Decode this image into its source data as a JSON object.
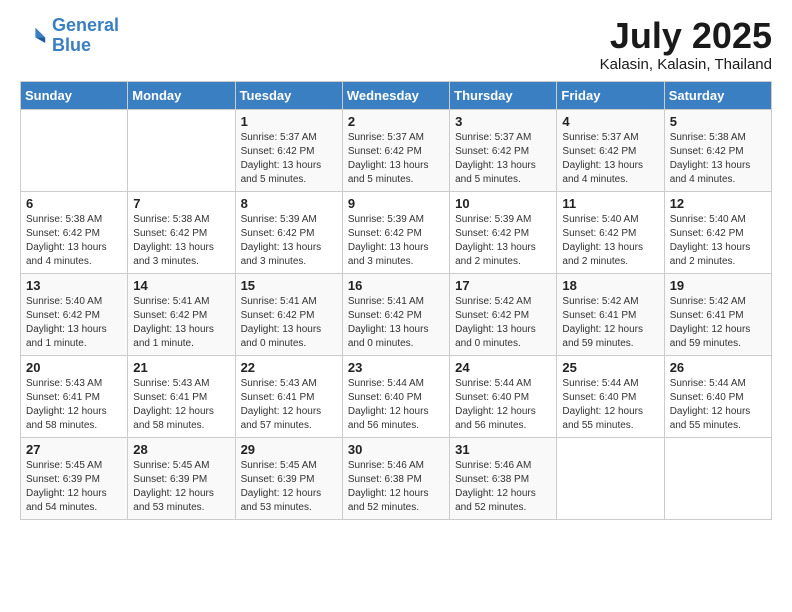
{
  "header": {
    "logo_line1": "General",
    "logo_line2": "Blue",
    "month": "July 2025",
    "location": "Kalasin, Kalasin, Thailand"
  },
  "days_of_week": [
    "Sunday",
    "Monday",
    "Tuesday",
    "Wednesday",
    "Thursday",
    "Friday",
    "Saturday"
  ],
  "weeks": [
    [
      {
        "day": "",
        "info": ""
      },
      {
        "day": "",
        "info": ""
      },
      {
        "day": "1",
        "info": "Sunrise: 5:37 AM\nSunset: 6:42 PM\nDaylight: 13 hours and 5 minutes."
      },
      {
        "day": "2",
        "info": "Sunrise: 5:37 AM\nSunset: 6:42 PM\nDaylight: 13 hours and 5 minutes."
      },
      {
        "day": "3",
        "info": "Sunrise: 5:37 AM\nSunset: 6:42 PM\nDaylight: 13 hours and 5 minutes."
      },
      {
        "day": "4",
        "info": "Sunrise: 5:37 AM\nSunset: 6:42 PM\nDaylight: 13 hours and 4 minutes."
      },
      {
        "day": "5",
        "info": "Sunrise: 5:38 AM\nSunset: 6:42 PM\nDaylight: 13 hours and 4 minutes."
      }
    ],
    [
      {
        "day": "6",
        "info": "Sunrise: 5:38 AM\nSunset: 6:42 PM\nDaylight: 13 hours and 4 minutes."
      },
      {
        "day": "7",
        "info": "Sunrise: 5:38 AM\nSunset: 6:42 PM\nDaylight: 13 hours and 3 minutes."
      },
      {
        "day": "8",
        "info": "Sunrise: 5:39 AM\nSunset: 6:42 PM\nDaylight: 13 hours and 3 minutes."
      },
      {
        "day": "9",
        "info": "Sunrise: 5:39 AM\nSunset: 6:42 PM\nDaylight: 13 hours and 3 minutes."
      },
      {
        "day": "10",
        "info": "Sunrise: 5:39 AM\nSunset: 6:42 PM\nDaylight: 13 hours and 2 minutes."
      },
      {
        "day": "11",
        "info": "Sunrise: 5:40 AM\nSunset: 6:42 PM\nDaylight: 13 hours and 2 minutes."
      },
      {
        "day": "12",
        "info": "Sunrise: 5:40 AM\nSunset: 6:42 PM\nDaylight: 13 hours and 2 minutes."
      }
    ],
    [
      {
        "day": "13",
        "info": "Sunrise: 5:40 AM\nSunset: 6:42 PM\nDaylight: 13 hours and 1 minute."
      },
      {
        "day": "14",
        "info": "Sunrise: 5:41 AM\nSunset: 6:42 PM\nDaylight: 13 hours and 1 minute."
      },
      {
        "day": "15",
        "info": "Sunrise: 5:41 AM\nSunset: 6:42 PM\nDaylight: 13 hours and 0 minutes."
      },
      {
        "day": "16",
        "info": "Sunrise: 5:41 AM\nSunset: 6:42 PM\nDaylight: 13 hours and 0 minutes."
      },
      {
        "day": "17",
        "info": "Sunrise: 5:42 AM\nSunset: 6:42 PM\nDaylight: 13 hours and 0 minutes."
      },
      {
        "day": "18",
        "info": "Sunrise: 5:42 AM\nSunset: 6:41 PM\nDaylight: 12 hours and 59 minutes."
      },
      {
        "day": "19",
        "info": "Sunrise: 5:42 AM\nSunset: 6:41 PM\nDaylight: 12 hours and 59 minutes."
      }
    ],
    [
      {
        "day": "20",
        "info": "Sunrise: 5:43 AM\nSunset: 6:41 PM\nDaylight: 12 hours and 58 minutes."
      },
      {
        "day": "21",
        "info": "Sunrise: 5:43 AM\nSunset: 6:41 PM\nDaylight: 12 hours and 58 minutes."
      },
      {
        "day": "22",
        "info": "Sunrise: 5:43 AM\nSunset: 6:41 PM\nDaylight: 12 hours and 57 minutes."
      },
      {
        "day": "23",
        "info": "Sunrise: 5:44 AM\nSunset: 6:40 PM\nDaylight: 12 hours and 56 minutes."
      },
      {
        "day": "24",
        "info": "Sunrise: 5:44 AM\nSunset: 6:40 PM\nDaylight: 12 hours and 56 minutes."
      },
      {
        "day": "25",
        "info": "Sunrise: 5:44 AM\nSunset: 6:40 PM\nDaylight: 12 hours and 55 minutes."
      },
      {
        "day": "26",
        "info": "Sunrise: 5:44 AM\nSunset: 6:40 PM\nDaylight: 12 hours and 55 minutes."
      }
    ],
    [
      {
        "day": "27",
        "info": "Sunrise: 5:45 AM\nSunset: 6:39 PM\nDaylight: 12 hours and 54 minutes."
      },
      {
        "day": "28",
        "info": "Sunrise: 5:45 AM\nSunset: 6:39 PM\nDaylight: 12 hours and 53 minutes."
      },
      {
        "day": "29",
        "info": "Sunrise: 5:45 AM\nSunset: 6:39 PM\nDaylight: 12 hours and 53 minutes."
      },
      {
        "day": "30",
        "info": "Sunrise: 5:46 AM\nSunset: 6:38 PM\nDaylight: 12 hours and 52 minutes."
      },
      {
        "day": "31",
        "info": "Sunrise: 5:46 AM\nSunset: 6:38 PM\nDaylight: 12 hours and 52 minutes."
      },
      {
        "day": "",
        "info": ""
      },
      {
        "day": "",
        "info": ""
      }
    ]
  ]
}
